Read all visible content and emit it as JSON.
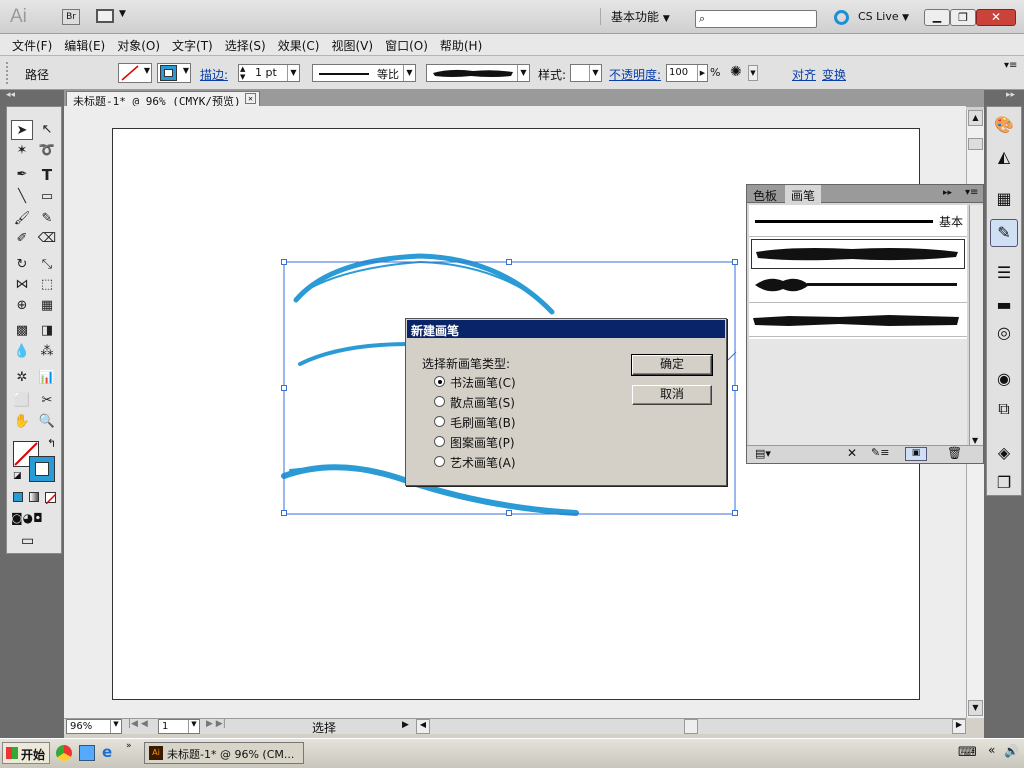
{
  "app": {
    "logo": "Ai",
    "bridge": "Br",
    "workspace": "基本功能",
    "cs_live": "CS Live",
    "search_placeholder": ""
  },
  "menu": [
    "文件(F)",
    "编辑(E)",
    "对象(O)",
    "文字(T)",
    "选择(S)",
    "效果(C)",
    "视图(V)",
    "窗口(O)",
    "帮助(H)"
  ],
  "control": {
    "selection_label": "路径",
    "stroke_label": "描边:",
    "stroke_weight": "1 pt",
    "stroke_profile": "等比",
    "style_label": "样式:",
    "opacity_label": "不透明度:",
    "opacity_value": "100",
    "opacity_unit": "%",
    "align_link": "对齐",
    "transform_link": "变换"
  },
  "document": {
    "tab_title": "未标题-1* @ 96% (CMYK/预览)"
  },
  "brush_panel": {
    "tab_swatches": "色板",
    "tab_brushes": "画笔",
    "brush_basic": "基本"
  },
  "dialog": {
    "title": "新建画笔",
    "prompt": "选择新画笔类型:",
    "ok": "确定",
    "cancel": "取消",
    "options": [
      "书法画笔(C)",
      "散点画笔(S)",
      "毛刷画笔(B)",
      "图案画笔(P)",
      "艺术画笔(A)"
    ],
    "selected_index": 0
  },
  "status": {
    "zoom": "96%",
    "artboard_number": "1",
    "status_label": "选择"
  },
  "taskbar": {
    "start": "开始",
    "task_label": "未标题-1* @ 96% (CM..."
  },
  "colors": {
    "accent_blue": "#2a9bd5",
    "dialog_title_bg": "#0a246a",
    "selection_blue": "#3a6fd8"
  }
}
